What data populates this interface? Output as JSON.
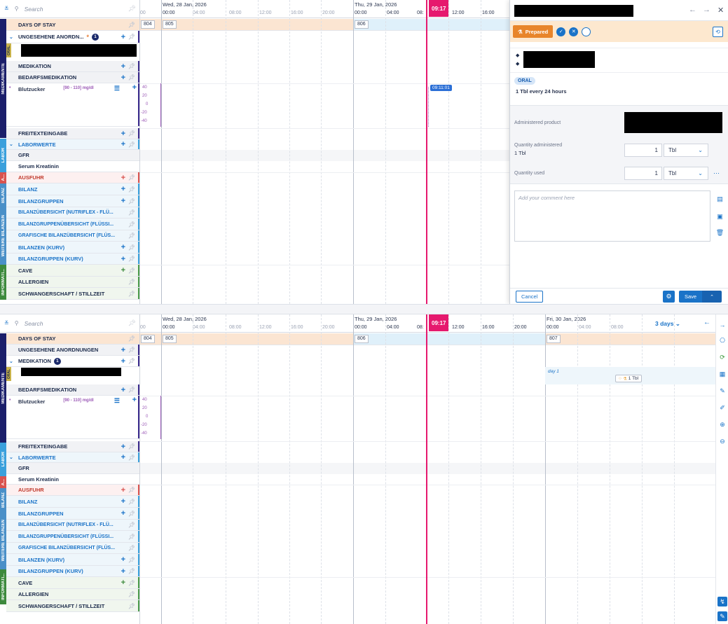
{
  "search": {
    "placeholder": "Search"
  },
  "top": {
    "rows": {
      "days_of_stay": "DAYS OF STAY",
      "ungesehene": "UNGESEHENE ANORDN...",
      "ungesehene_count": "1",
      "medikation": "MEDIKATION",
      "bedarfsmedikation": "BEDARFSMEDIKATION",
      "blutzucker": "Blutzucker",
      "blutzucker_range": "[90 - 110] mg/dl",
      "freitext": "FREITEXTEINGABE",
      "laborwerte": "LABORWERTE",
      "gfr": "GFR",
      "serum": "Serum Kreatinin",
      "ausfuhr": "AUSFUHR",
      "bilanz": "BILANZ",
      "bilanzgruppen": "BILANZGRUPPEN",
      "bilanzuebersicht": "BILANZÜBERSICHT (NUTRIFLEX - FLÜ...",
      "bilanzgruppenuebersicht": "BILANZGRUPPENÜBERSICHT (FLÜSSI...",
      "grafische": "GRAFISCHE BILANZÜBERSICHT (FLÜS...",
      "bilanzen_kurv": "BILANZEN (KURV)",
      "bilanzgruppen_kurv": "BILANZGRUPPEN (KURV)",
      "cave": "CAVE",
      "allergien": "ALLERGIEN",
      "schwanger": "SCHWANGERSCHAFT / STILLZEIT"
    },
    "strips": {
      "medikamente": "MEDIKAMENTE",
      "oral": "ORAL",
      "labor": "LABOR",
      "ausfuhr": "A...",
      "bilanz": "BILANZ",
      "weitere": "WEITERE BILANZEN",
      "informati": "INFORMATI..."
    },
    "day1": "Wed, 28 Jan, 2026",
    "day2": "Thu, 29 Jan, 2026",
    "hours1": [
      "00",
      "00:00",
      "04:00",
      "08:00",
      "12:00",
      "16:00",
      "20:00"
    ],
    "hours2": [
      "00:00",
      "04:00",
      "08:",
      "12:00",
      "16:00"
    ],
    "stays": [
      "804",
      "805",
      "806"
    ],
    "now": "09:17",
    "bubble": "09:11:01",
    "ticks": [
      "40",
      "20",
      "0",
      "-20",
      "-40"
    ]
  },
  "bottom": {
    "rows": {
      "days_of_stay": "DAYS OF STAY",
      "ungesehene": "UNGESEHENE ANORDNUNGEN",
      "medikation": "MEDIKATION",
      "medikation_count": "1",
      "bedarfsmedikation": "BEDARFSMEDIKATION",
      "blutzucker": "Blutzucker",
      "blutzucker_range": "[90 - 110] mg/dl",
      "freitext": "FREITEXTEINGABE",
      "laborwerte": "LABORWERTE",
      "gfr": "GFR",
      "serum": "Serum Kreatinin",
      "ausfuhr": "AUSFUHR",
      "bilanz": "BILANZ",
      "bilanzgruppen": "BILANZGRUPPEN",
      "bilanzuebersicht": "BILANZÜBERSICHT (NUTRIFLEX - FLÜ...",
      "bilanzgruppenuebersicht": "BILANZGRUPPENÜBERSICHT (FLÜSSI...",
      "grafische": "GRAFISCHE BILANZÜBERSICHT (FLÜS...",
      "bilanzen_kurv": "BILANZEN (KURV)",
      "bilanzgruppen_kurv": "BILANZGRUPPEN (KURV)",
      "cave": "CAVE",
      "allergien": "ALLERGIEN",
      "schwanger": "SCHWANGERSCHAFT / STILLZEIT"
    },
    "day1": "Wed, 28 Jan, 2026",
    "day2": "Thu, 29 Jan, 2026",
    "day3": "Fri, 30 Jan, 2026",
    "hours1": [
      "00",
      "00:00",
      "04:00",
      "08:00",
      "12:00",
      "16:00",
      "20:00"
    ],
    "hours2": [
      "00:00",
      "04:00",
      "08:",
      "12:00",
      "16:00",
      "20:00"
    ],
    "hours3": [
      "00:00",
      "04:00",
      "08:00"
    ],
    "stays": [
      "804",
      "805",
      "806",
      "807"
    ],
    "now": "09:17",
    "range": "3 days",
    "day_label": "day 1",
    "admin_label": "1 Tbl",
    "ticks": [
      "40",
      "20",
      "0",
      "-20",
      "-40"
    ]
  },
  "detail": {
    "status": "Prepared",
    "route": "ORAL",
    "dose": "1 Tbl every 24 hours",
    "administered_product": "Administered product",
    "qty_admin_label": "Quantity administered",
    "qty_admin_sub": "1 Tbl",
    "qty_admin_value": "1",
    "qty_admin_unit": "Tbl",
    "qty_used_label": "Quantity used",
    "qty_used_value": "1",
    "qty_used_unit": "Tbl",
    "comment_placeholder": "Add your comment here",
    "cancel": "Cancel",
    "save": "Save"
  },
  "colors": {
    "accent": "#1a73c8",
    "now": "#e6196e",
    "prepared": "#e8852b",
    "medikamente": "#1b1f6b",
    "labor": "#3aa0dc",
    "ausfuhr": "#d9534f",
    "bilanz": "#4a90c8",
    "informati": "#3d8a3d"
  }
}
